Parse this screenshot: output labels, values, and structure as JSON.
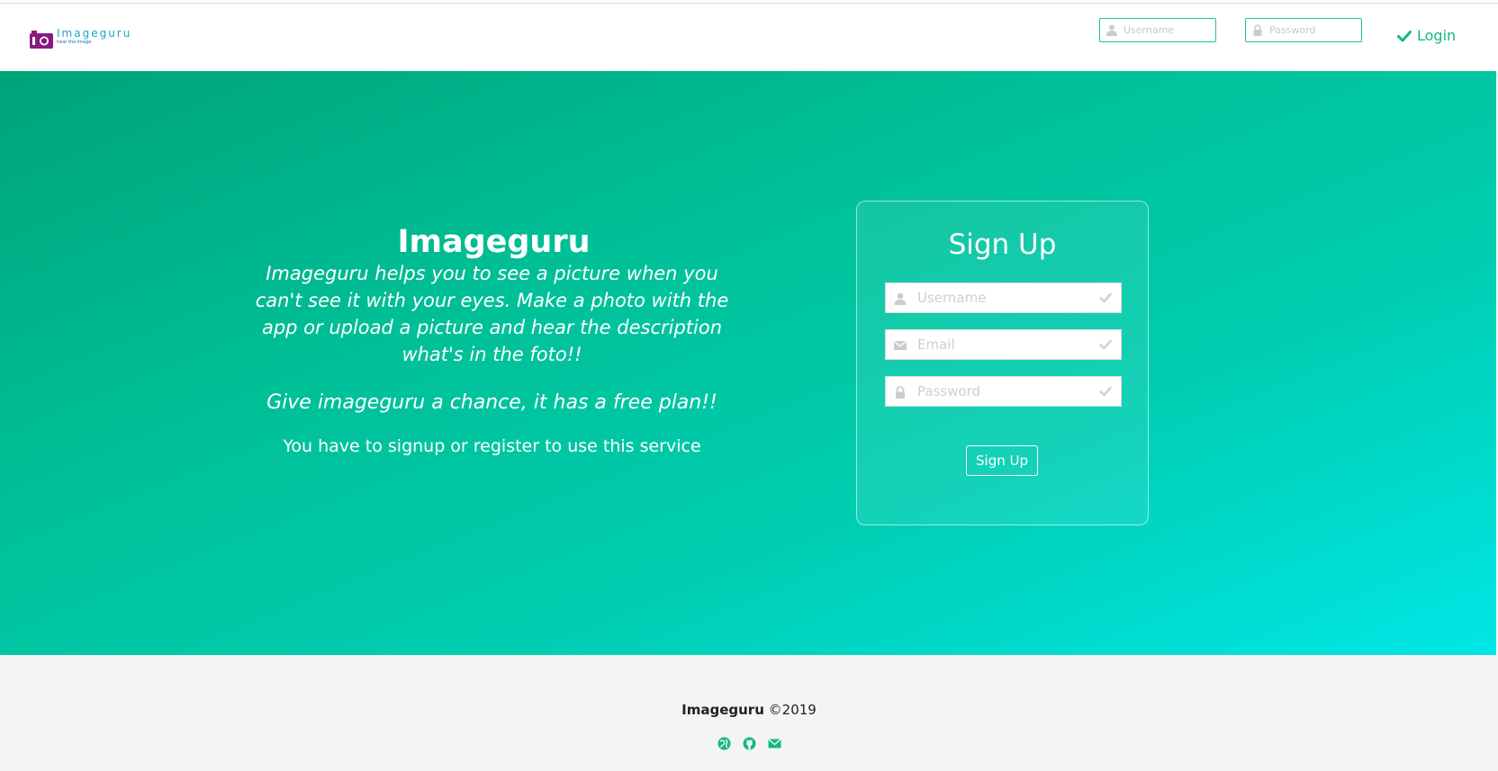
{
  "brand": {
    "name": "Imageguru",
    "tagline": "hear the image"
  },
  "nav": {
    "username_placeholder": "Username",
    "password_placeholder": "Password",
    "login_label": "Login"
  },
  "intro": {
    "title": "Imageguru",
    "description": "Imageguru helps you to see a picture when you can't see it with your eyes. Make a photo with the app or upload a picture and hear the description what's in the foto!!",
    "chance": "Give imageguru a chance, it has a free plan!!",
    "note": "You have to signup or register to use this service"
  },
  "signup": {
    "title": "Sign Up",
    "username_placeholder": "Username",
    "email_placeholder": "Email",
    "password_placeholder": "Password",
    "button_label": "Sign Up"
  },
  "footer": {
    "brand": "Imageguru",
    "copyright": "©2019",
    "icons": [
      "globe-icon",
      "github-icon",
      "envelope-icon"
    ]
  },
  "colors": {
    "accent": "#14b87e",
    "brand_purple": "#8a1a7e",
    "brand_blue": "#1aa6c9",
    "hero_start": "#00a37a",
    "hero_end": "#00e6e6",
    "footer_bg": "#f4f4f4"
  }
}
